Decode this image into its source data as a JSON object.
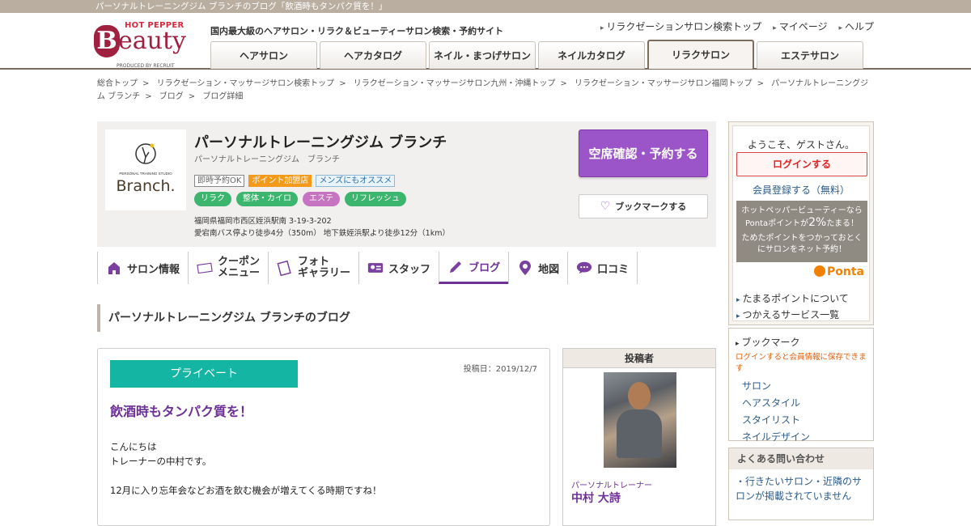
{
  "topbar": {
    "text": "パーソナルトレーニングジム ブランチのブログ「飲酒時もタンパク質を！」"
  },
  "logo": {
    "hotpepper": "HOT PEPPER",
    "b": "B",
    "eauty": "eauty",
    "produced": "PRODUCED BY RECRUIT"
  },
  "header": {
    "tagline": "国内最大級のヘアサロン・リラク＆ビューティーサロン検索・予約サイト",
    "links": [
      "リラクゼーションサロン検索トップ",
      "マイページ",
      "ヘルプ"
    ],
    "tabs": [
      "ヘアサロン",
      "ヘアカタログ",
      "ネイル・まつげサロン",
      "ネイルカタログ",
      "リラクサロン",
      "エステサロン"
    ]
  },
  "breadcrumb": [
    "総合トップ",
    "リラクゼーション・マッサージサロン検索トップ",
    "リラクゼーション・マッサージサロン九州・沖縄トップ",
    "リラクゼーション・マッサージサロン福岡トップ",
    "パーソナルトレーニングジム ブランチ",
    "ブログ",
    "ブログ詳細"
  ],
  "salon": {
    "logo_text": "Branch.",
    "logo_sub": "PERSONAL TRAINING STUDIO",
    "name": "パーソナルトレーニングジム ブランチ",
    "kana": "パーソナルトレーニングジム　ブランチ",
    "badges": [
      "即時予約OK",
      "ポイント加盟店",
      "メンズにもオススメ"
    ],
    "categories": [
      "リラク",
      "整体・カイロ",
      "エステ",
      "リフレッシュ"
    ],
    "address": "福岡県福岡市西区姪浜駅南 3-19-3-202",
    "access": "愛宕南バス停より徒歩4分（350m） 地下鉄姪浜駅より徒歩12分（1km）",
    "reserve_label": "空席確認・予約する",
    "bookmark_label": "ブックマークする"
  },
  "salon_nav": {
    "info": "サロン情報",
    "coupon1": "クーポン",
    "coupon2": "メニュー",
    "photo1": "フォト",
    "photo2": "ギャラリー",
    "staff": "スタッフ",
    "blog": "ブログ",
    "map": "地図",
    "review": "口コミ"
  },
  "section_title": "パーソナルトレーニングジム ブランチのブログ",
  "article": {
    "category": "プライベート",
    "date": "投稿日：2019/12/7",
    "title": "飲酒時もタンパク質を！",
    "body": [
      "こんにちは",
      "トレーナーの中村です。",
      "",
      "12月に入り忘年会などお酒を飲む機会が増えてくる時期ですね！"
    ]
  },
  "poster": {
    "header": "投稿者",
    "role": "パーソナルトレーナー",
    "name": "中村 大詩"
  },
  "sidebar": {
    "welcome": "ようこそ、ゲストさん。",
    "login": "ログインする",
    "register": "会員登録する（無料）",
    "ponta_l1": "ホットペッパービューティーなら",
    "ponta_l2a": "Pontaポイントが",
    "ponta_pct": "2%",
    "ponta_l2b": "たまる！",
    "ponta_l3": "ためたポイントをつかっておとく",
    "ponta_l4": "にサロンをネット予約！",
    "ponta_logo": "Ponta",
    "links": [
      "たまるポイントについて",
      "つかえるサービス一覧"
    ],
    "bookmark_title": "ブックマーク",
    "bookmark_note": "ログインすると会員情報に保存できます",
    "bookmark_items": [
      "サロン",
      "ヘアスタイル",
      "スタイリスト",
      "ネイルデザイン"
    ],
    "faq_title": "よくある問い合わせ",
    "faq_item": "行きたいサロン・近隣のサロンが掲載されていません"
  },
  "colors": {
    "accent": "#6d2f98",
    "reserve": "#9c55c9",
    "teal": "#14b5a2",
    "brand": "#a0203f"
  }
}
